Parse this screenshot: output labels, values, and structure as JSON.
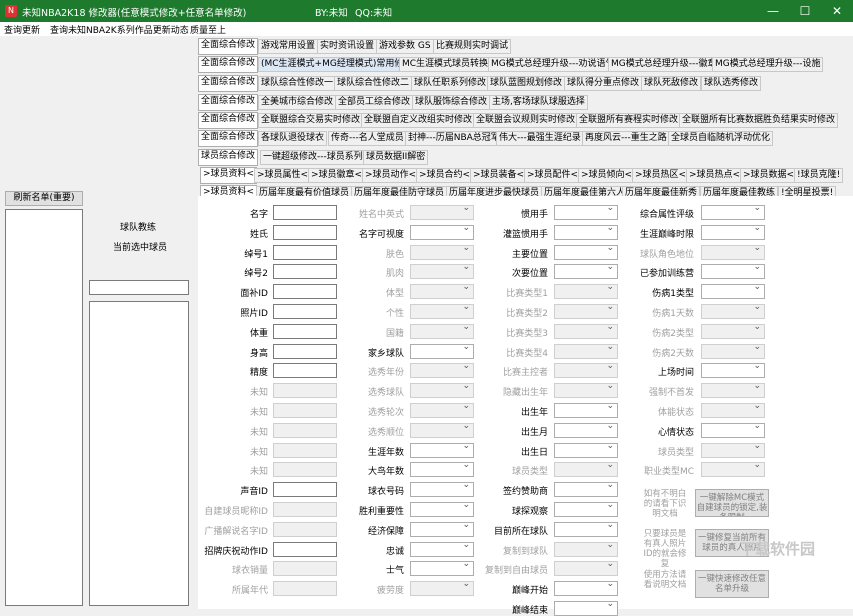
{
  "window": {
    "title": "未知NBA2K18 修改器(任意模式修改+任意名单修改)",
    "author": "BY:未知",
    "qq": "QQ:未知"
  },
  "menu": [
    "查询更新",
    "查询未知NBA2K系列作品更新动态",
    "质量至上"
  ],
  "left": {
    "refresh_label": "刷新名单(重要)",
    "team_coach": "球队教练",
    "current_player": "当前选中球员"
  },
  "tabs_top": [
    "全面综合修改",
    "游戏常用设置",
    "实时资讯设置",
    "游戏参数 GS",
    "比赛规则实时调试"
  ],
  "tab_rows": [
    [
      "全面综合修改",
      "(MC生涯模式+MG经理模式)常用修改",
      "MC生涯模式球员转换",
      "MG模式总经理升级---劝说语气",
      "MG模式总经理升级---徽章",
      "MG模式总经理升级---设施"
    ],
    [
      "全面综合修改",
      "球队综合性修改一",
      "球队综合性修改二",
      "球队任职系列修改",
      "球队蓝图规划修改",
      "球队得分重点修改",
      "球队死敌修改",
      "球队选秀修改"
    ],
    [
      "全面综合修改",
      "全美城市综合修改",
      "全部员工综合修改",
      "球队服饰综合修改",
      "主场,客场球队球服选择"
    ],
    [
      "全面综合修改",
      "全联盟综合交易实时修改",
      "全联盟自定义改组实时修改",
      "全联盟会议规则实时修改",
      "全联盟所有赛程实时修改",
      "全联盟所有比赛数据胜负结果实时修改"
    ],
    [
      "全面综合修改",
      "各球队退役球衣",
      "传奇---名人堂成员",
      "封神---历届NBA总冠军",
      "伟大---最强生涯纪录",
      "再度风云---重生之路",
      "全球员自临随机浮动优化"
    ],
    [
      "球员综合修改",
      "一键超级修改---球员系列",
      "球员数据II解密"
    ],
    [
      ">球员资料<",
      ">球员属性<",
      ">球员徽章<",
      ">球员动作<",
      ">球员合约<",
      ">球员装备<",
      ">球员配件<",
      ">球员倾向<",
      ">球员热区<",
      ">球员热点<",
      ">球员数据<",
      "!球员克隆!"
    ],
    [
      ">球员资料<",
      "历届年度最有价值球员",
      "历届年度最佳防守球员",
      "历届年度进步最快球员",
      "历届年度最佳第六人",
      "历届年度最佳新秀",
      "历届年度最佳教练",
      "!全明星投票!"
    ]
  ],
  "fields": {
    "c1": [
      "名字",
      "姓氏",
      "绰号1",
      "绰号2",
      "面补ID",
      "照片ID",
      "体重",
      "身高",
      "精度",
      "未知",
      "未知",
      "未知",
      "未知",
      "未知",
      "声音ID",
      "自建球员昵称ID",
      "广播解说名字ID",
      "招牌庆祝动作ID",
      "球衣销量",
      "所属年代"
    ],
    "c2": [
      "姓名中英式",
      "名字可视度",
      "肤色",
      "肌肉",
      "体型",
      "个性",
      "国籍",
      "家乡球队",
      "选秀年份",
      "选秀球队",
      "选秀轮次",
      "选秀顺位",
      "生涯年数",
      "大鸟年数",
      "球衣号码",
      "胜利重要性",
      "经济保障",
      "忠诚",
      "士气",
      "疲劳度"
    ],
    "c3": [
      "惯用手",
      "灌篮惯用手",
      "主要位置",
      "次要位置",
      "比赛类型1",
      "比赛类型2",
      "比赛类型3",
      "比赛类型4",
      "比赛主控者",
      "隐藏出生年",
      "出生年",
      "出生月",
      "出生日",
      "球员类型",
      "签约赞助商",
      "球探观察",
      "目前所在球队",
      "复制到球队",
      "复制到自由球员",
      "巅峰开始",
      "巅峰结束"
    ],
    "c4": [
      "综合属性评级",
      "生涯巅峰时限",
      "球队角色地位",
      "已参加训练营",
      "伤病1类型",
      "伤病1天数",
      "伤病2类型",
      "伤病2天数",
      "上场时间",
      "强制不首发",
      "体能状态",
      "心情状态",
      "球员类型",
      "职业类型MC"
    ]
  },
  "notes": {
    "n1": "如有不明白的请看下识明文档",
    "n2": "只要球员是有真人照片ID的就会修复",
    "n3": "使用方法请看说明文档"
  },
  "buttons": {
    "b1": "一键解除MC模式自建球员的锁定,装备限制",
    "b2": "一键修复当前所有球员的真人照片",
    "b3": "一键快速修改任意名单升级"
  },
  "watermark": "下载软件园"
}
